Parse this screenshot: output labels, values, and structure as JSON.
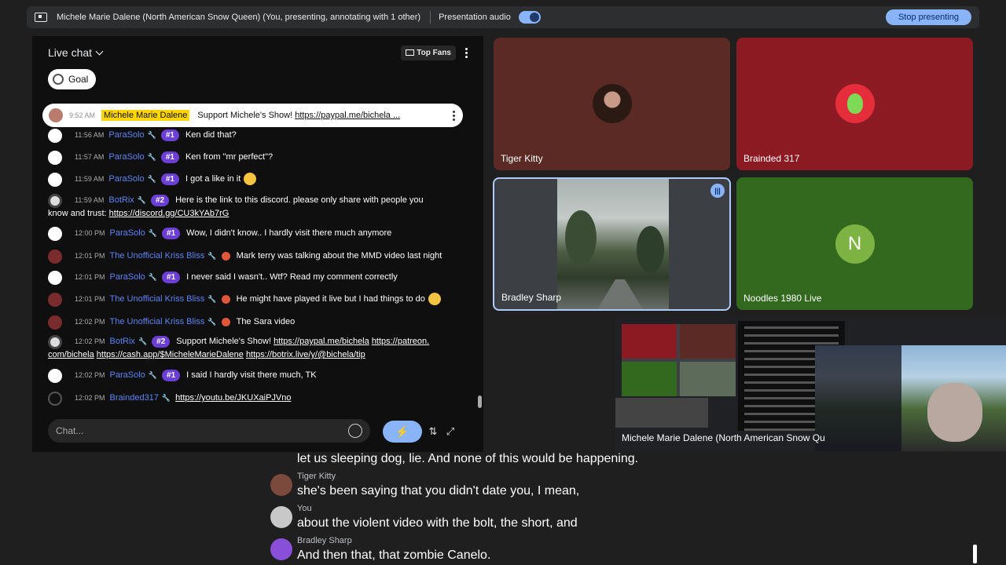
{
  "topbar": {
    "presenting_text": "Michele Marie Dalene (North American Snow Queen) (You, presenting, annotating with 1 other)",
    "audio_label": "Presentation audio",
    "stop_label": "Stop presenting",
    "audio_on": true
  },
  "chat": {
    "title": "Live chat",
    "top_fans": "Top Fans",
    "goal": "Goal",
    "pinned": {
      "time": "9:52 AM",
      "author": "Michele Marie Dalene",
      "text": "Support Michele's Show!",
      "link": "https://paypal.me/bichela ..."
    },
    "messages": [
      {
        "time": "11:56 AM",
        "author": "ParaSolo",
        "rank": "#1",
        "text": "Ken did that?"
      },
      {
        "time": "11:57 AM",
        "author": "ParaSolo",
        "rank": "#1",
        "text": "Ken from \"mr perfect\"?"
      },
      {
        "time": "11:59 AM",
        "author": "ParaSolo",
        "rank": "#1",
        "text": "I got a like in it"
      },
      {
        "time": "11:59 AM",
        "author": "BotRix",
        "rank": "#2",
        "text": "Here is the link to this discord. please only share with people you",
        "text2": "know and trust:",
        "link": "https://discord.gg/CU3kYAb7rG"
      },
      {
        "time": "12:00 PM",
        "author": "ParaSolo",
        "rank": "#1",
        "text": "Wow, I didn't know.. I hardly visit there much anymore"
      },
      {
        "time": "12:01 PM",
        "author": "The Unofficial Kriss Bliss",
        "text": "Mark terry was talking about the MMD video last night"
      },
      {
        "time": "12:01 PM",
        "author": "ParaSolo",
        "rank": "#1",
        "text": "I never said I wasn't.. Wtf? Read my comment correctly"
      },
      {
        "time": "12:01 PM",
        "author": "The Unofficial Kriss Bliss",
        "text": "He might have played it live but I had things to do"
      },
      {
        "time": "12:02 PM",
        "author": "The Unofficial Kriss Bliss",
        "text": "The Sara video"
      },
      {
        "time": "12:02 PM",
        "author": "BotRix",
        "rank": "#2",
        "text": "Support Michele's Show!",
        "link": "https://paypal.me/bichela",
        "link2": "https://patreon.",
        "link3": "com/bichela",
        "link4": "https://cash.app/$MicheleMarieDalene",
        "link5": "https://botrix.live/y/@bichela/tip"
      },
      {
        "time": "12:02 PM",
        "author": "ParaSolo",
        "rank": "#1",
        "text": "I said I hardly visit there much, TK"
      },
      {
        "time": "12:02 PM",
        "author": "Brainded317",
        "link": "https://youtu.be/JKUXaiPJVno"
      }
    ],
    "input_placeholder": "Chat..."
  },
  "tiles": [
    {
      "name": "Tiger Kitty"
    },
    {
      "name": "Brainded 317"
    },
    {
      "name": "Bradley Sharp"
    },
    {
      "name": "Noodles 1980 Live",
      "initial": "N"
    }
  ],
  "presentation": {
    "name": "Michele Marie Dalene (North American Snow Qu"
  },
  "captions": [
    {
      "speaker": "",
      "text": "let us sleeping dog, lie. And none of this would be happening."
    },
    {
      "speaker": "Tiger Kitty",
      "text": "she's been saying that you didn't date you, I mean,"
    },
    {
      "speaker": "You",
      "text": "about the violent video with the bolt, the short, and"
    },
    {
      "speaker": "Bradley Sharp",
      "text": "And then that, that zombie Canelo."
    }
  ],
  "colors": {
    "accent": "#8ab4f8",
    "author_blue": "#5e84f1",
    "rank_purple": "#6b3fd6",
    "pinned_highlight": "#ffd600"
  }
}
